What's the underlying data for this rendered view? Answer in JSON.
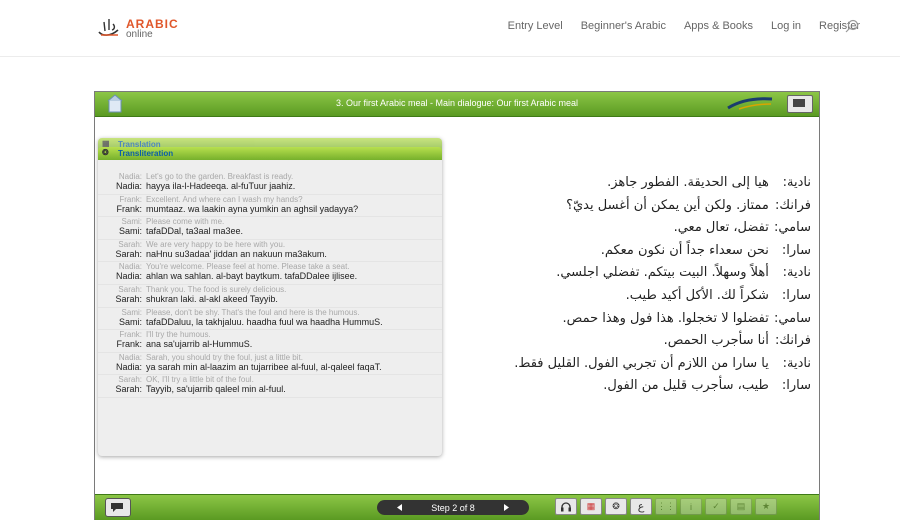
{
  "header": {
    "logo_top": "ARABIC",
    "logo_bottom": "online",
    "nav": [
      "Entry Level",
      "Beginner's Arabic",
      "Apps & Books",
      "Log in",
      "Register"
    ]
  },
  "lesson": {
    "title": "3. Our first Arabic meal - Main dialogue: Our first Arabic meal",
    "tab_translation": "Translation",
    "tab_transliteration": "Transliteration",
    "entries": [
      {
        "speaker": "Nadia:",
        "translation": "Let's go to the garden. Breakfast is ready.",
        "translit": "hayya ila-l-Hadeeqa. al-fuTuur jaahiz."
      },
      {
        "speaker": "Frank:",
        "translation": "Excellent. And where can I wash my hands?",
        "translit": "mumtaaz. wa laakin ayna yumkin an aghsil yadayya?"
      },
      {
        "speaker": "Sami:",
        "translation": "Please come with me.",
        "translit": "tafaDDal, ta3aal ma3ee."
      },
      {
        "speaker": "Sarah:",
        "translation": "We are very happy to be here with you.",
        "translit": "naHnu su3adaa' jiddan an nakuun ma3akum."
      },
      {
        "speaker": "Nadia:",
        "translation": "You're welcome. Please feel at home. Please take a seat.",
        "translit": "ahlan wa sahlan. al-bayt baytkum. tafaDDalee ijlisee."
      },
      {
        "speaker": "Sarah:",
        "translation": "Thank you. The food is surely delicious.",
        "translit": "shukran laki. al-akl akeed Tayyib."
      },
      {
        "speaker": "Sami:",
        "translation": "Please, don't be shy. That's the foul and here is the humous.",
        "translit": "tafaDDaluu, la takhjaluu. haadha fuul wa haadha HummuS."
      },
      {
        "speaker": "Frank:",
        "translation": "I'll try the humous.",
        "translit": "ana sa'ujarrib al-HummuS."
      },
      {
        "speaker": "Nadia:",
        "translation": "Sarah, you should try the foul, just a little bit.",
        "translit": "ya sarah min al-laazim an tujarribee al-fuul, al-qaleel faqaT."
      },
      {
        "speaker": "Sarah:",
        "translation": "OK, I'll try a little bit of the foul.",
        "translit": "Tayyib, sa'ujarrib qaleel min al-fuul."
      }
    ],
    "arabic_lines": [
      {
        "speaker": "نادية:",
        "text": "هيا إلى الحديقة. الفطور جاهز."
      },
      {
        "speaker": "فرانك:",
        "text": "ممتاز. ولكن أين يمكن أن أغسل يديّ؟"
      },
      {
        "speaker": "سامي:",
        "text": "تفضل، تعال معي."
      },
      {
        "speaker": "سارا:",
        "text": "نحن سعداء جداً أن نكون معكم."
      },
      {
        "speaker": "نادية:",
        "text": "أهلاً وسهلاً. البيت بيتكم. تفضلي اجلسي."
      },
      {
        "speaker": "سارا:",
        "text": "شكراً لك. الأكل أكيد طيب."
      },
      {
        "speaker": "سامي:",
        "text": "تفضلوا لا تخجلوا. هذا فول وهذا حمص."
      },
      {
        "speaker": "فرانك:",
        "text": "أنا سأجرب الحمص."
      },
      {
        "speaker": "نادية:",
        "text": "يا سارا من اللازم أن تجربي الفول. القليل فقط."
      },
      {
        "speaker": "سارا:",
        "text": "طيب، سأجرب قليل من الفول."
      }
    ],
    "step_label": "Step 2 of 8",
    "arabic_tool_glyph": "ع"
  }
}
